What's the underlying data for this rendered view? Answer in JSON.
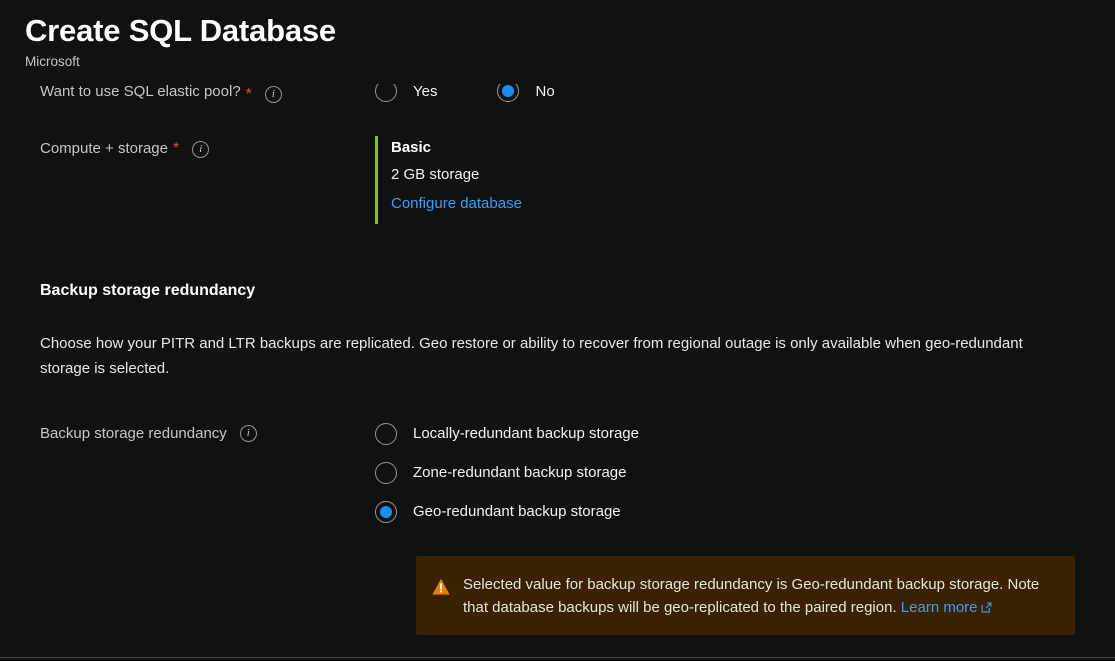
{
  "header": {
    "title": "Create SQL Database",
    "publisher": "Microsoft"
  },
  "form": {
    "elastic_pool": {
      "label": "Want to use SQL elastic pool?",
      "required_mark": "*",
      "info_icon": "info-icon",
      "options": [
        {
          "label": "Yes",
          "selected": false
        },
        {
          "label": "No",
          "selected": true
        }
      ]
    },
    "compute_storage": {
      "label": "Compute + storage",
      "required_mark": "*",
      "info_icon": "info-icon",
      "tier": "Basic",
      "size": "2 GB storage",
      "configure_link": "Configure database",
      "accent_color": "#8cbf26"
    }
  },
  "backup_section": {
    "heading": "Backup storage redundancy",
    "description": "Choose how your PITR and LTR backups are replicated. Geo restore or ability to recover from regional outage is only available when geo-redundant storage is selected.",
    "field_label": "Backup storage redundancy",
    "info_icon": "info-icon",
    "options": [
      {
        "label": "Locally-redundant backup storage",
        "selected": false
      },
      {
        "label": "Zone-redundant backup storage",
        "selected": false
      },
      {
        "label": "Geo-redundant backup storage",
        "selected": true
      }
    ]
  },
  "warning": {
    "icon": "warning-triangle-icon",
    "text": "Selected value for backup storage redundancy is Geo-redundant backup storage. Note that database backups will be geo-replicated to the paired region. ",
    "link_label": "Learn more",
    "link_icon": "external-link-icon",
    "background_color": "#3a2200",
    "icon_color": "#e38000"
  },
  "colors": {
    "page_background": "#111111",
    "accent_blue": "#1b8cf5",
    "link_blue": "#3aa0f3",
    "required_red": "#e74c3c"
  }
}
